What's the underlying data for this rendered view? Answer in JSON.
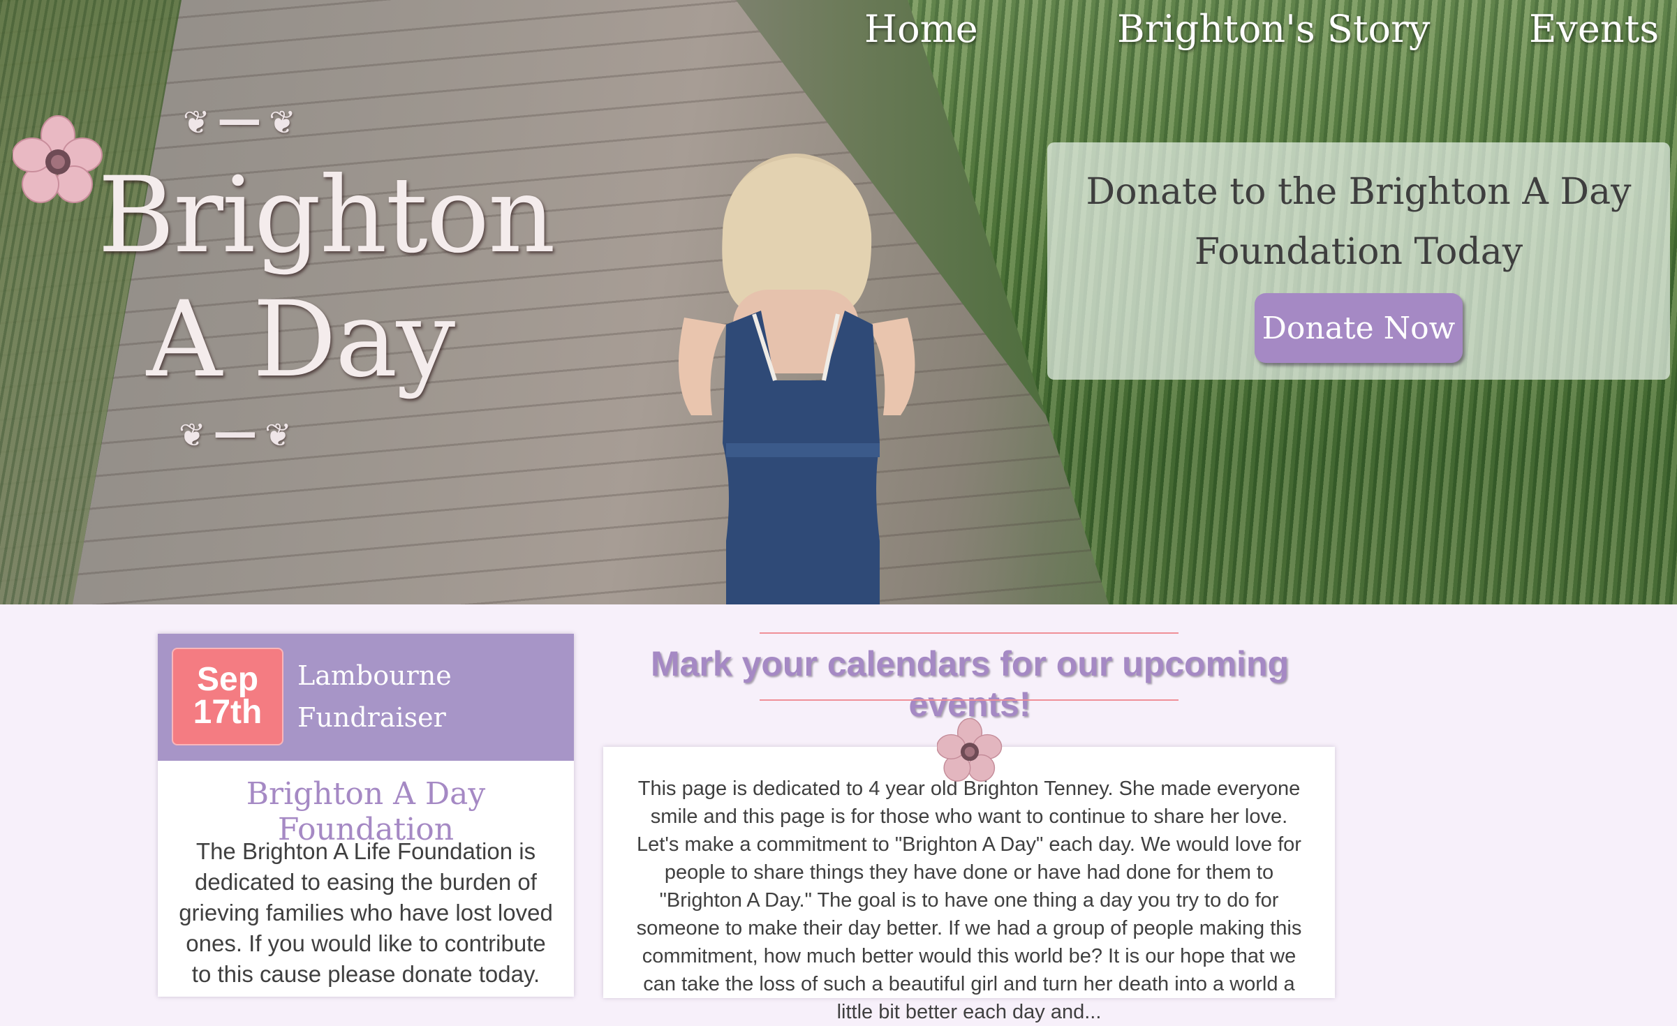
{
  "brand": {
    "title_line1": "Brighton",
    "title_line2": "A Day"
  },
  "nav": {
    "items": [
      {
        "label": "Home"
      },
      {
        "label": "Brighton's Story"
      },
      {
        "label": "Events"
      }
    ]
  },
  "donate": {
    "heading_line1": "Donate to the Brighton A Day",
    "heading_line2": "Foundation Today",
    "button_label": "Donate Now"
  },
  "event_card": {
    "month": "Sep",
    "day": "17th",
    "name_line1": "Lambourne",
    "name_line2": "Fundraiser",
    "organization": "Brighton A Day Foundation",
    "description": "The Brighton A Life Foundation is dedicated to easing the burden of grieving families who have lost loved ones. If you would like to contribute to this cause please donate today."
  },
  "events_section": {
    "heading": "Mark your calendars for our upcoming events!",
    "story": "This page is dedicated to 4 year old Brighton Tenney. She made everyone smile and this page is for those who want to continue to share her love. Let's make a commitment to \"Brighton A Day\" each day. We would love for people to share things they have done or have had done for them to \"Brighton A Day.\" The goal is to have one thing a day you try to do for someone to make their day better. If we had a group of people making this commitment, how much better would this world be? It is our hope that we can take the loss of such a beautiful girl and turn her death into a world a little bit better each day and..."
  },
  "colors": {
    "accent_purple": "#a589c4",
    "event_header": "#a795c7",
    "date_badge": "#f47c82",
    "page_bg": "#f7f0fa"
  },
  "icons": {
    "logo": "flower-icon",
    "divider": "flower-icon"
  }
}
